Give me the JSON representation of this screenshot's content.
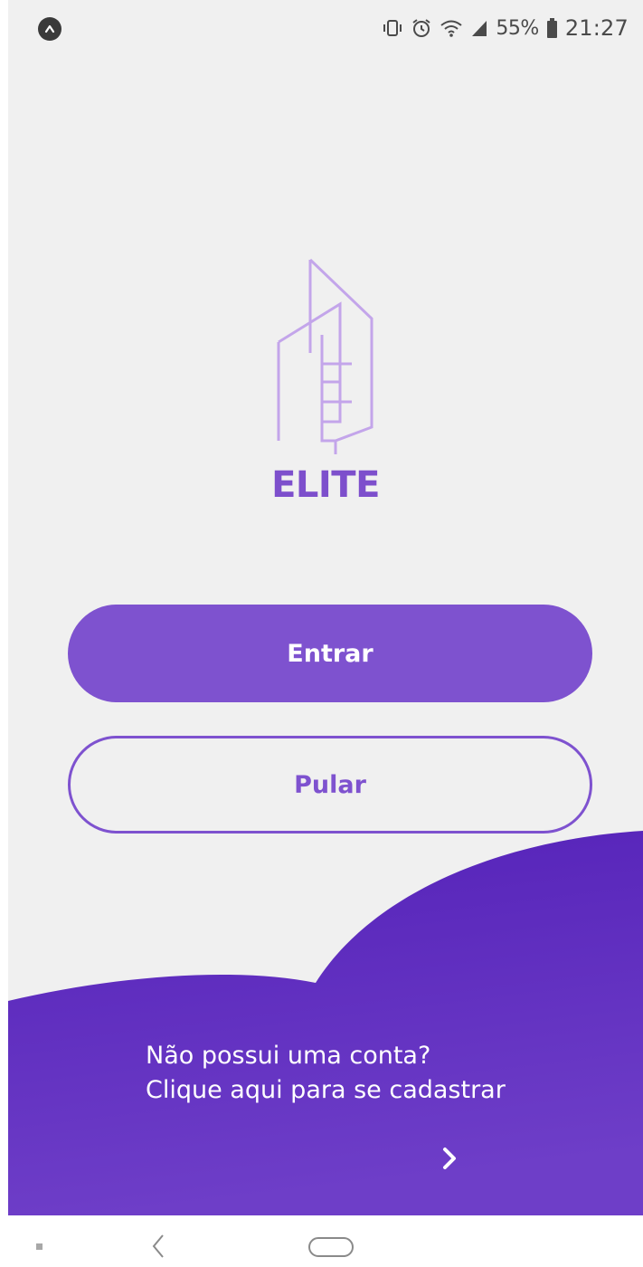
{
  "status_bar": {
    "app_badge_icon": "notification-app-icon",
    "icons": [
      "vibrate-icon",
      "alarm-icon",
      "wifi-icon",
      "signal-icon",
      "battery-icon"
    ],
    "battery": "55%",
    "time": "21:27"
  },
  "brand": {
    "logo_icon": "building-logo-icon",
    "title": "ELITE"
  },
  "actions": {
    "login_label": "Entrar",
    "skip_label": "Pular"
  },
  "signup": {
    "line1": "Não possui uma conta?",
    "line2": "Clique aqui para se cadastrar",
    "arrow_icon": "chevron-right-icon"
  },
  "nav": {
    "recents_icon": "recents-icon",
    "back_icon": "back-icon",
    "home_icon": "home-icon"
  },
  "colors": {
    "accent": "#7e52cf",
    "background": "#f0f0f0",
    "wave": "#5f2dbd",
    "logo_stroke": "#c3a5ea"
  }
}
